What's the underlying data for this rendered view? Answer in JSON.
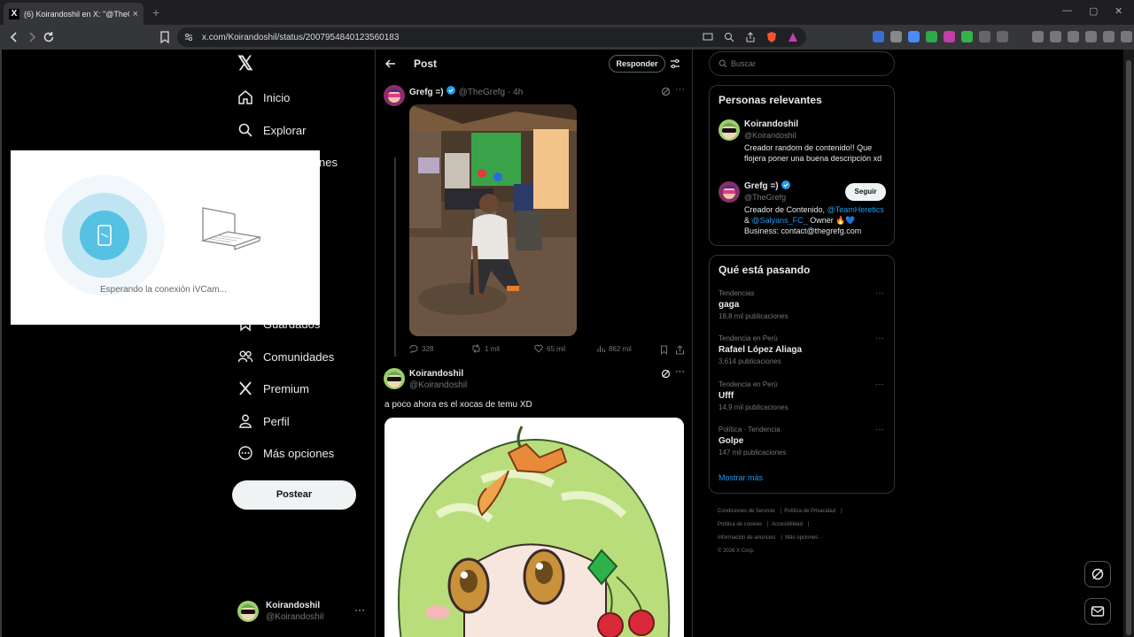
{
  "browser": {
    "tab_title": "(6) Koirandoshil en X: \"@TheGre",
    "tab_close": "×",
    "new_tab": "+",
    "url": "x.com/Koirandoshil/status/2007954840123560183",
    "win_min": "—",
    "win_max": "▢",
    "win_close": "✕"
  },
  "sidebar": {
    "logo": "𝕏",
    "items": [
      {
        "label": "Inicio",
        "icon": "home-icon"
      },
      {
        "label": "Explorar",
        "icon": "search-icon"
      },
      {
        "label": "Notificaciones",
        "icon": "bell-icon"
      },
      {
        "label": "Guardados",
        "icon": "bookmark-icon"
      },
      {
        "label": "Comunidades",
        "icon": "people-icon"
      },
      {
        "label": "Premium",
        "icon": "x-icon"
      },
      {
        "label": "Perfil",
        "icon": "person-icon"
      },
      {
        "label": "Más opciones",
        "icon": "more-circle-icon"
      }
    ],
    "partial_nes": "nes",
    "post_button": "Postear",
    "account": {
      "name": "Koirandoshil",
      "handle": "@Koirandoshil",
      "more": "···"
    }
  },
  "ivcam": {
    "waiting_text": "Esperando la conexión iVCam..."
  },
  "main": {
    "title": "Post",
    "reply_button": "Responder",
    "tweet1": {
      "name": "Grefg =)",
      "handle": "@TheGrefg",
      "time": "· 4h",
      "replies": "328",
      "retweets": "1 mil",
      "likes": "65 mil",
      "views": "862 mil"
    },
    "tweet2": {
      "name": "Koirandoshil",
      "handle": "@Koirandoshil",
      "text": "a poco ahora es el xocas de temu XD"
    }
  },
  "right": {
    "search_placeholder": "Buscar",
    "relevant_title": "Personas relevantes",
    "person1": {
      "name": "Koirandoshil",
      "handle": "@Koirandoshil",
      "bio1": "Creador random de contenido!! Que",
      "bio2": "flojera poner una buena descripción xd"
    },
    "person2": {
      "name": "Grefg =)",
      "handle": "@TheGrefg",
      "follow": "Seguir",
      "bio_line1_prefix": "Creador de Contenido, ",
      "bio_link1": "@TeamHeretics",
      "bio_line2_prefix": "& ",
      "bio_link2": "@Salyans_FC_",
      "bio_line2_suffix": " Owner 🔥💙",
      "bio_line3": "Business: contact@thegrefg.com"
    },
    "trending_title": "Qué está pasando",
    "trends": [
      {
        "category": "Tendencias",
        "title": "gaga",
        "count": "18,8 mil publicaciones"
      },
      {
        "category": "Tendencia en Perú",
        "title": "Rafael López Aliaga",
        "count": "3.614 publicaciones"
      },
      {
        "category": "Tendencia en Perú",
        "title": "Ufff",
        "count": "14,9 mil publicaciones"
      },
      {
        "category": "Política · Tendencia",
        "title": "Golpe",
        "count": "147 mil publicaciones"
      }
    ],
    "show_more": "Mostrar más",
    "footer": {
      "terms": "Condiciones de Servicio",
      "privacy": "Política de Privacidad",
      "cookies": "Política de cookies",
      "accessibility": "Accesibilidad",
      "ads": "Información de anuncios",
      "more": "Más opciones ···",
      "copyright": "© 2026 X Corp."
    }
  },
  "colors": {
    "accent": "#1d9bf0",
    "background": "#000000",
    "text": "#e7e9ea",
    "muted": "#71767b"
  }
}
